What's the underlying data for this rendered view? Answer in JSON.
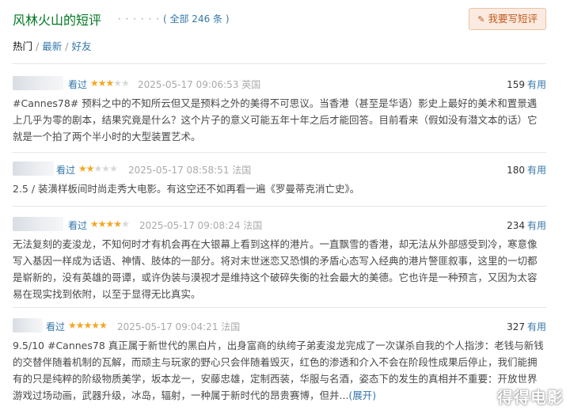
{
  "header": {
    "title": "风林火山的短评",
    "dots": "· · · · · ·",
    "count": "( 全部 246 条 )",
    "write_button": "我要写短评"
  },
  "tabs": [
    {
      "label": "热门",
      "active": true
    },
    {
      "label": "最新",
      "active": false
    },
    {
      "label": "好友",
      "active": false
    }
  ],
  "reviews": [
    {
      "seen": "看过",
      "stars": 3,
      "time": "2025-05-17 09:06:53",
      "location": "英国",
      "useful_count": "159",
      "useful_label": "有用",
      "content": "#Cannes78# 预料之中的不知所云但又是预料之外的美得不可思议。当香港（甚至是华语）影史上最好的美术和置景遇上几乎为零的剧本，结果究竟是什么？这个片子的意义可能五年十年之后才能回答。目前看来（假如没有潜文本的话）它就是一个拍了两个半小时的大型装置艺术。"
    },
    {
      "seen": "看过",
      "stars": 2,
      "time": "2025-05-17 08:58:51",
      "location": "法国",
      "useful_count": "180",
      "useful_label": "有用",
      "content": "2.5 / 装潢样板间时尚走秀大电影。有这空还不如再看一遍《罗曼蒂克消亡史》。"
    },
    {
      "seen": "看过",
      "stars": 4,
      "time": "2025-05-17 09:08:24",
      "location": "法国",
      "useful_count": "234",
      "useful_label": "有用",
      "content": "无法复刻的麦浚龙，不知何时才有机会再在大银幕上看到这样的港片。一直飘雪的香港，却无法从外部感受到冷，寒意像写入基因一样成为话语、神情、肢体的一部分。将对末世迷恋又恐惧的矛盾心态写入经典的港片警匪叙事，这里的一切都是崭新的，没有英雄的哥谭，或许伪装与漠视才是维持这个破碎失衡的社会最大的美德。它也许是一种预言，又因为太容易在现实找到依附，以至于显得无比真实。"
    },
    {
      "seen": "看过",
      "stars": 5,
      "time": "2025-05-17 09:04:21",
      "location": "法国",
      "useful_count": "327",
      "useful_label": "有用",
      "content": "9.5/10 #Cannes78 真正属于新世代的黑白片，出身富商的纨绔子弟麦浚龙完成了一次谋杀自我的个人指涉：老钱与新钱的交替伴随着机制的瓦解，而顽主与玩家的野心只会伴随着毁灭，红色的渗透和介入不会在阶段性成果后停止，我们能拥有的只是纯粹的阶级物质美学，坂本龙一，安藤忠雄，定制西装，华服与名酒，姿态下的发生的真相并不重要：开放世界游戏过场动画，武器升级，冰岛，辐射，一种属于新时代的昂贵赛博，但并...",
      "expand": "(展开)"
    }
  ],
  "watermark": "得得电影",
  "colors": {
    "title_green": "#007722",
    "link_blue": "#3377aa",
    "star_orange": "#f5a623",
    "button_bg": "#fbeadf",
    "button_text": "#c25b1e"
  }
}
